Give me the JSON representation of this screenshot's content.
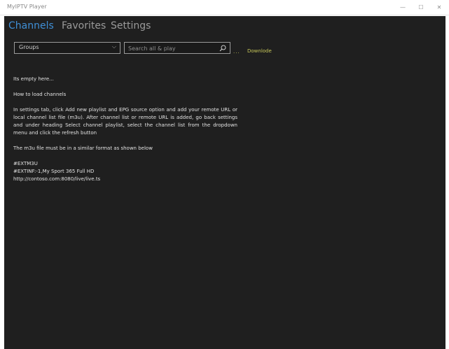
{
  "window": {
    "title": "MyIPTV Player",
    "minimize_glyph": "—",
    "maximize_glyph": "☐",
    "close_glyph": "✕"
  },
  "tabs": [
    {
      "label": "Channels",
      "active": true
    },
    {
      "label": "Favorites",
      "active": false
    },
    {
      "label": "Settings",
      "active": false
    }
  ],
  "toolbar": {
    "groups_value": "Groups",
    "chevron_glyph": "⌵",
    "search_placeholder": "Search all & play",
    "download_dots": "...",
    "download_label": "Downlode"
  },
  "content": {
    "empty_message": "Its empty here...",
    "howto_heading": "How to load channels",
    "instructions": "In settings tab, click Add new playlist and EPG source option and add your remote URL or local channel list file (m3u). After channel list or remote URL is added, go back settings and under heading Select channel playlist, select the channel list from the dropdown menu and click the refresh button",
    "format_note": "The m3u file must be in a similar format as shown below",
    "example_lines": [
      "#EXTM3U",
      "#EXTINF:-1,My Sport 365 Full HD",
      "http://contoso.com:8080/live/live.ts"
    ]
  },
  "colors": {
    "accent": "#3f8fd6",
    "app_background": "#1f1f1f",
    "download_link": "#c8c85a"
  }
}
